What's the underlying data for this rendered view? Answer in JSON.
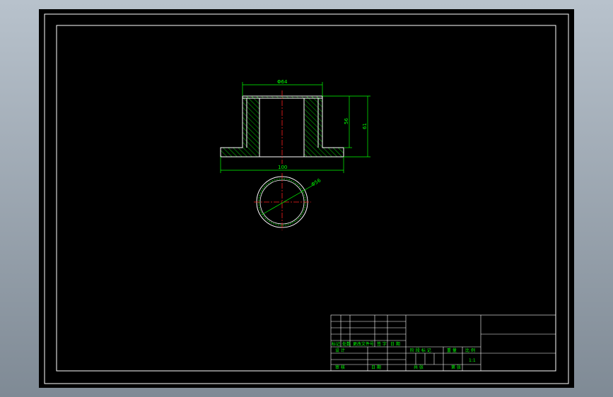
{
  "colors": {
    "viewport_bg_top": "#b8c2cc",
    "viewport_bg_bottom": "#7f8a95",
    "sheet": "#000000",
    "frame": "#ffffff",
    "outline": "#ffffff",
    "hatch": "#00ff00",
    "dimension": "#00ff00",
    "centerline": "#ff2020",
    "text": "#00ff00"
  },
  "dimensions": {
    "top_width": "Φ64",
    "base_width": "100",
    "inner_height": "56",
    "overall_height": "61",
    "diameter": "Φ56"
  },
  "title_block": {
    "rev_row_cells": [
      "标记",
      "处数",
      "更改文件号",
      "签 字",
      "日 期"
    ],
    "designer_label": "设 计",
    "review_label": "审 核",
    "process_label": "工 艺",
    "approve_label": "批 准",
    "stage_label": "阶 段 标 记",
    "weight_label": "重 量",
    "scale_label": "比 例",
    "scale_value": "1:1",
    "sheet_total_label": "共 张",
    "sheet_label": "第 张",
    "date_label": "日 期"
  }
}
